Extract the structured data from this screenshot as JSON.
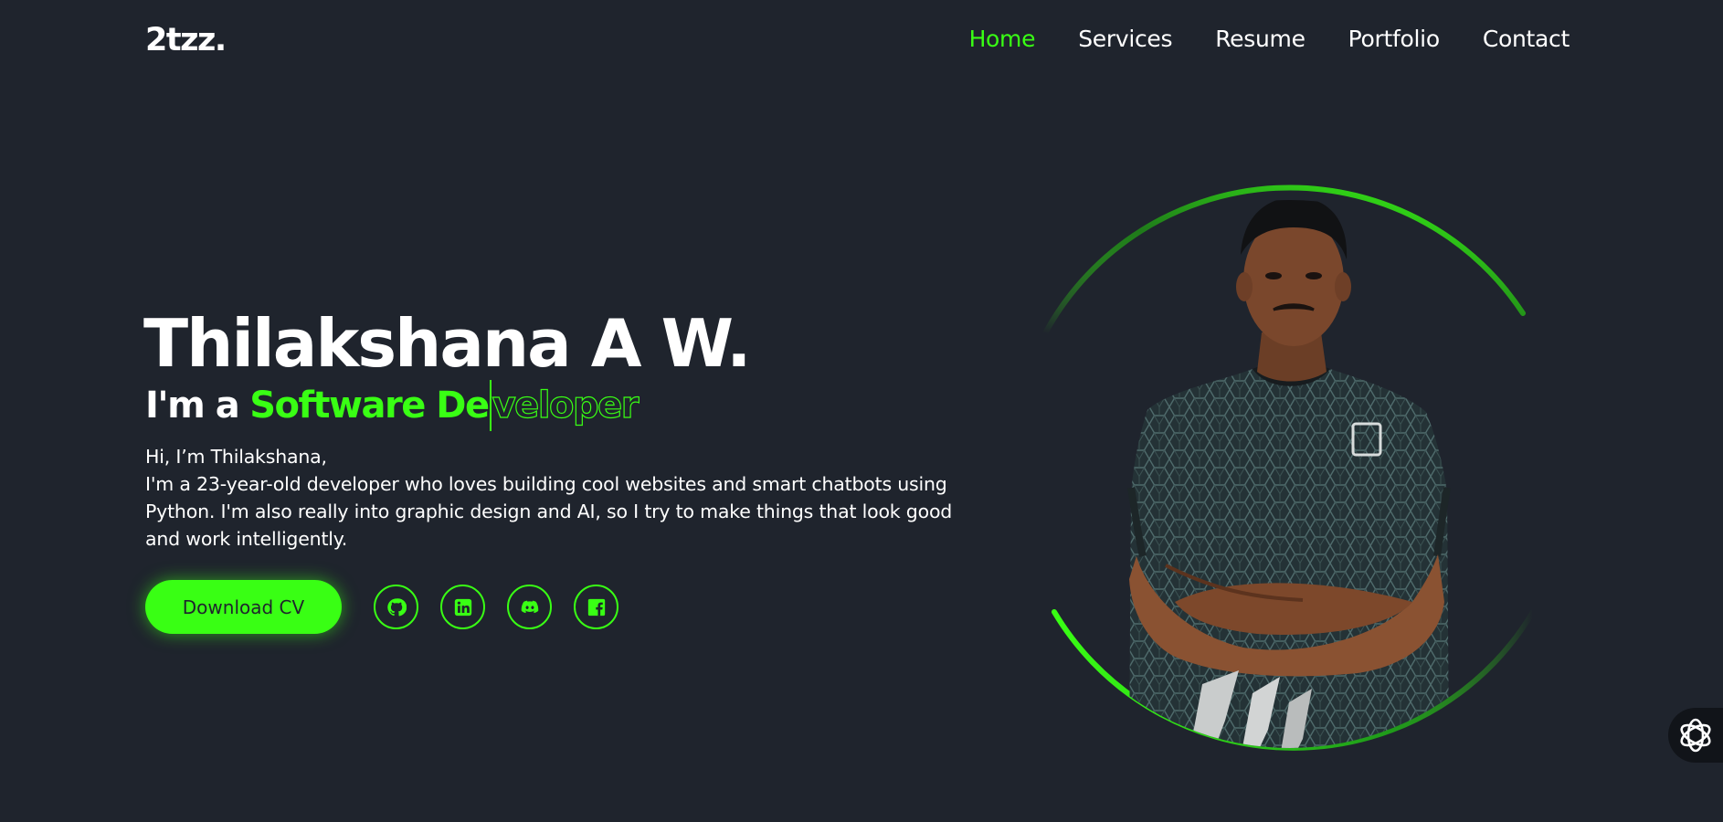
{
  "brand": {
    "logo": "2tzz."
  },
  "nav": {
    "items": [
      {
        "label": "Home",
        "active": true
      },
      {
        "label": "Services",
        "active": false
      },
      {
        "label": "Resume",
        "active": false
      },
      {
        "label": "Portfolio",
        "active": false
      },
      {
        "label": "Contact",
        "active": false
      }
    ]
  },
  "hero": {
    "name": "Thilakshana A W.",
    "role_prefix": "I'm a",
    "role_typed": "Software De",
    "role_remaining": "veloper",
    "greeting": "Hi, I’m Thilakshana,",
    "intro_lines": [
      "I'm a 23-year-old developer who loves building cool websites and smart chatbots using",
      "Python. I'm also really into graphic design and AI, so I try to make things that look good",
      "and work intelligently."
    ],
    "cta_label": "Download CV"
  },
  "socials": [
    {
      "icon": "github-icon"
    },
    {
      "icon": "linkedin-icon"
    },
    {
      "icon": "discord-icon"
    },
    {
      "icon": "facebook-icon"
    }
  ],
  "colors": {
    "accent": "#39ff14",
    "background": "#1f242d",
    "text": "#ffffff"
  }
}
